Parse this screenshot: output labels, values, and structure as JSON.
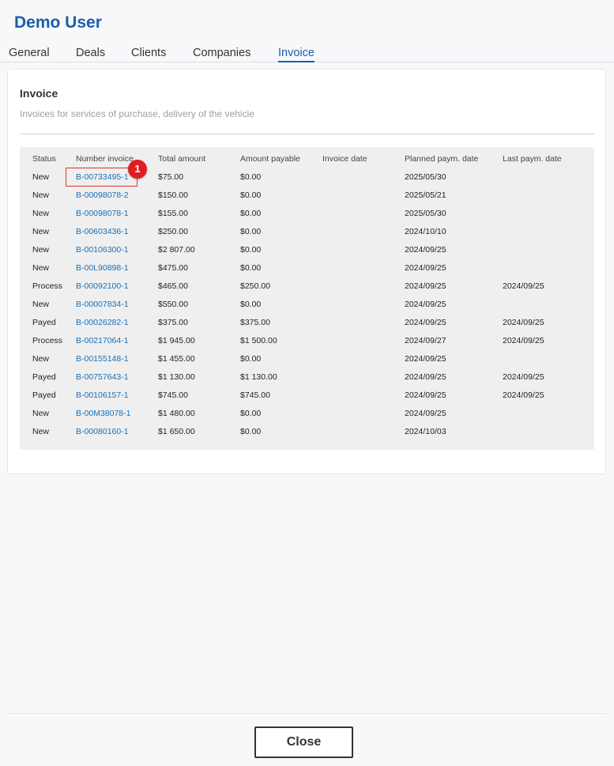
{
  "header": {
    "title": "Demo User"
  },
  "tabs": [
    {
      "label": "General",
      "active": false
    },
    {
      "label": "Deals",
      "active": false
    },
    {
      "label": "Clients",
      "active": false
    },
    {
      "label": "Companies",
      "active": false
    },
    {
      "label": "Invoice",
      "active": true
    }
  ],
  "invoice_section": {
    "title": "Invoice",
    "subtitle": "Invoices for services of purchase, delivery of the vehicle"
  },
  "table": {
    "columns": [
      "Status",
      "Number invoice",
      "Total amount",
      "Amount payable",
      "Invoice date",
      "Planned paym. date",
      "Last paym. date"
    ],
    "rows": [
      {
        "status": "New",
        "number": "B-00733495-1",
        "total": "$75.00",
        "payable": "$0.00",
        "invoice_date": "",
        "planned": "2025/05/30",
        "last": ""
      },
      {
        "status": "New",
        "number": "B-00098078-2",
        "total": "$150.00",
        "payable": "$0.00",
        "invoice_date": "",
        "planned": "2025/05/21",
        "last": ""
      },
      {
        "status": "New",
        "number": "B-00098078-1",
        "total": "$155.00",
        "payable": "$0.00",
        "invoice_date": "",
        "planned": "2025/05/30",
        "last": ""
      },
      {
        "status": "New",
        "number": "B-00603436-1",
        "total": "$250.00",
        "payable": "$0.00",
        "invoice_date": "",
        "planned": "2024/10/10",
        "last": ""
      },
      {
        "status": "New",
        "number": "B-00106300-1",
        "total": "$2 807.00",
        "payable": "$0.00",
        "invoice_date": "",
        "planned": "2024/09/25",
        "last": ""
      },
      {
        "status": "New",
        "number": "B-00L90898-1",
        "total": "$475.00",
        "payable": "$0.00",
        "invoice_date": "",
        "planned": "2024/09/25",
        "last": ""
      },
      {
        "status": "Process",
        "number": "B-00092100-1",
        "total": "$465.00",
        "payable": "$250.00",
        "invoice_date": "",
        "planned": "2024/09/25",
        "last": "2024/09/25"
      },
      {
        "status": "New",
        "number": "B-00007834-1",
        "total": "$550.00",
        "payable": "$0.00",
        "invoice_date": "",
        "planned": "2024/09/25",
        "last": ""
      },
      {
        "status": "Payed",
        "number": "B-00026282-1",
        "total": "$375.00",
        "payable": "$375.00",
        "invoice_date": "",
        "planned": "2024/09/25",
        "last": "2024/09/25"
      },
      {
        "status": "Process",
        "number": "B-00217064-1",
        "total": "$1 945.00",
        "payable": "$1 500.00",
        "invoice_date": "",
        "planned": "2024/09/27",
        "last": "2024/09/25"
      },
      {
        "status": "New",
        "number": "B-00155148-1",
        "total": "$1 455.00",
        "payable": "$0.00",
        "invoice_date": "",
        "planned": "2024/09/25",
        "last": ""
      },
      {
        "status": "Payed",
        "number": "B-00757643-1",
        "total": "$1 130.00",
        "payable": "$1 130.00",
        "invoice_date": "",
        "planned": "2024/09/25",
        "last": "2024/09/25"
      },
      {
        "status": "Payed",
        "number": "B-00106157-1",
        "total": "$745.00",
        "payable": "$745.00",
        "invoice_date": "",
        "planned": "2024/09/25",
        "last": "2024/09/25"
      },
      {
        "status": "New",
        "number": "B-00M38078-1",
        "total": "$1 480.00",
        "payable": "$0.00",
        "invoice_date": "",
        "planned": "2024/09/25",
        "last": ""
      },
      {
        "status": "New",
        "number": "B-00080160-1",
        "total": "$1 650.00",
        "payable": "$0.00",
        "invoice_date": "",
        "planned": "2024/10/03",
        "last": ""
      }
    ]
  },
  "annotation": {
    "marker_label": "1"
  },
  "footer": {
    "close_label": "Close"
  },
  "colors": {
    "brand": "#1b5ea8",
    "link": "#1a6fb5",
    "marker": "#e11d22"
  }
}
